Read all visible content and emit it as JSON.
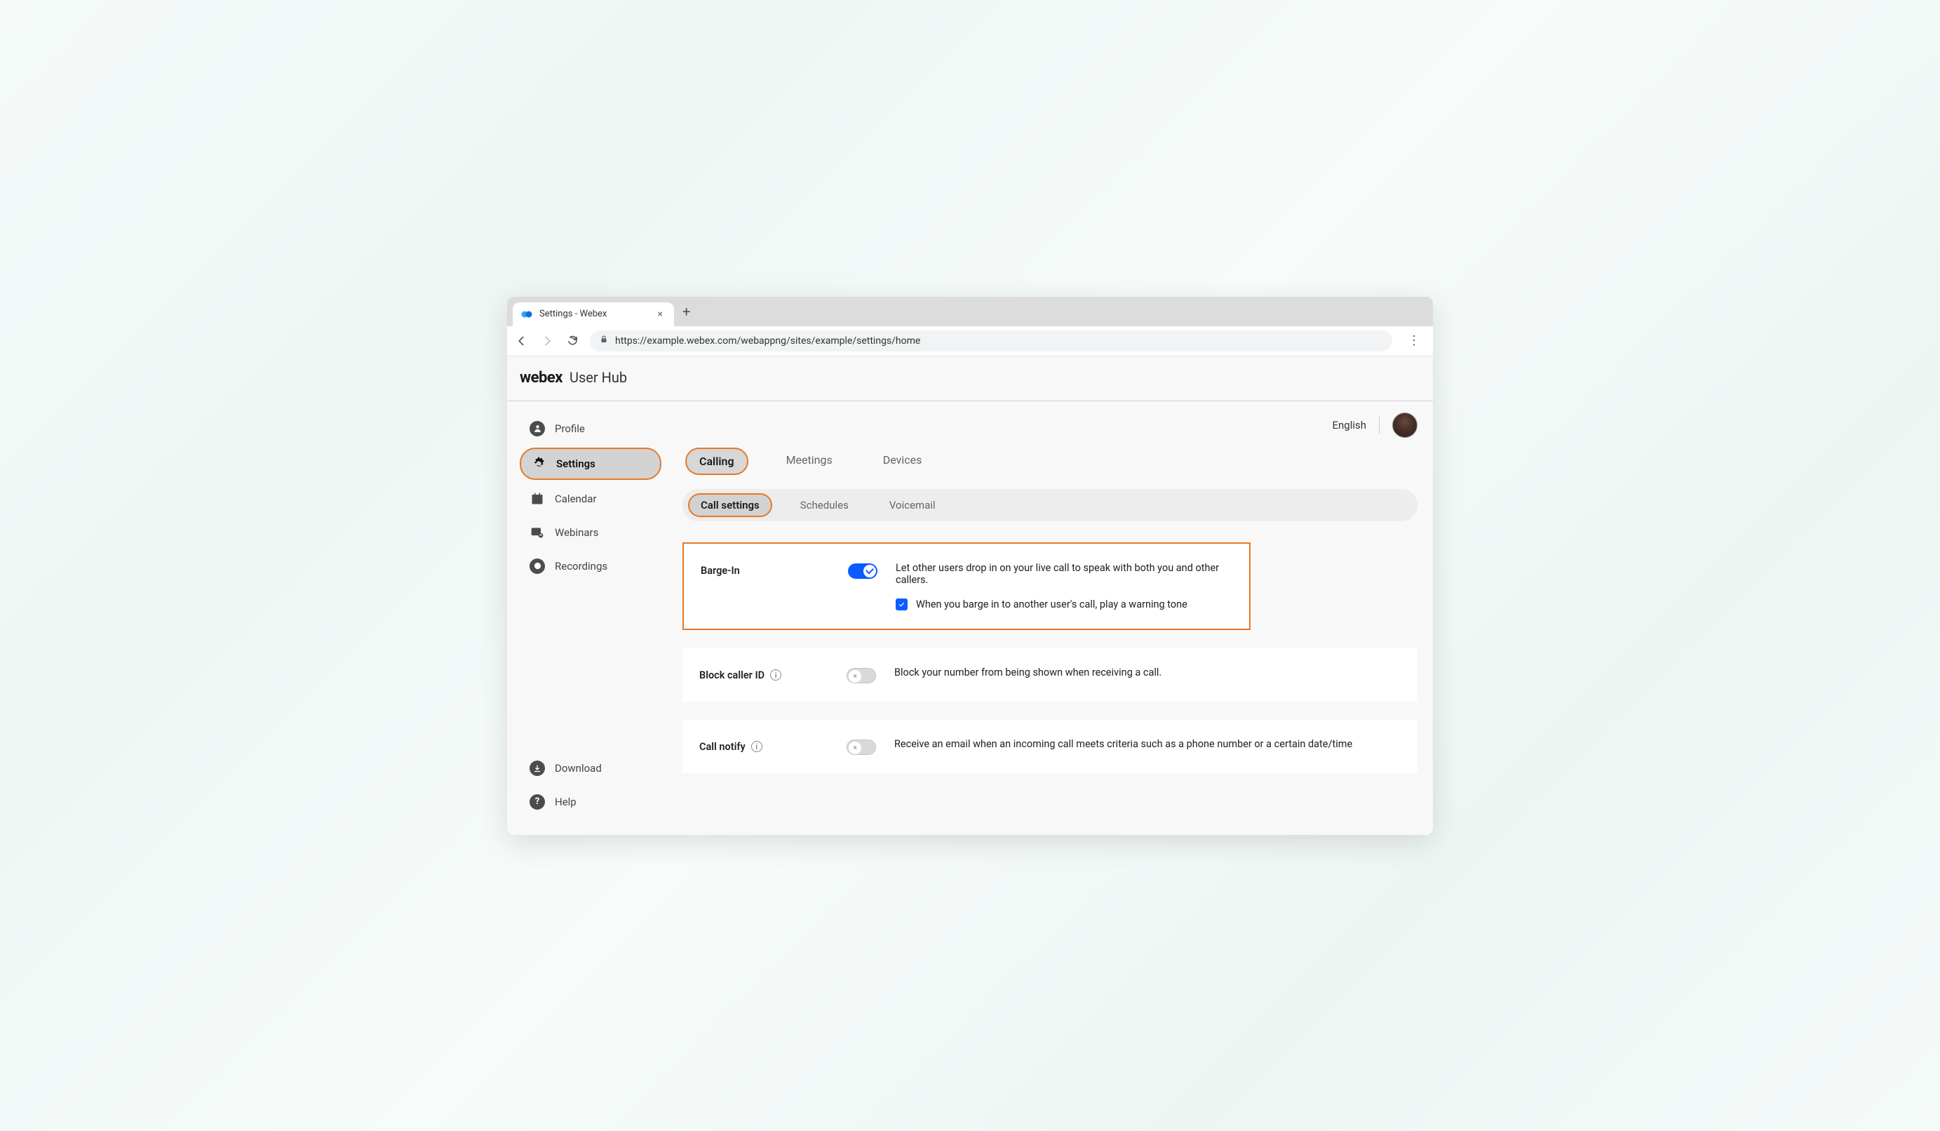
{
  "browser": {
    "tab_title": "Settings - Webex",
    "url": "https://example.webex.com/webappng/sites/example/settings/home"
  },
  "header": {
    "brand": "webex",
    "sub": "User Hub"
  },
  "sidebar": {
    "items": [
      {
        "label": "Profile"
      },
      {
        "label": "Settings"
      },
      {
        "label": "Calendar"
      },
      {
        "label": "Webinars"
      },
      {
        "label": "Recordings"
      }
    ],
    "bottom": [
      {
        "label": "Download"
      },
      {
        "label": "Help"
      }
    ]
  },
  "topbar": {
    "language": "English"
  },
  "main_tabs": {
    "items": [
      "Calling",
      "Meetings",
      "Devices"
    ]
  },
  "sub_tabs": {
    "items": [
      "Call settings",
      "Schedules",
      "Voicemail"
    ]
  },
  "settings": {
    "barge_in": {
      "label": "Barge-In",
      "enabled": true,
      "description": "Let other users drop in on your live call to speak with both you and other callers.",
      "sub_option": {
        "checked": true,
        "label": "When you barge in to another user's call, play a warning tone"
      }
    },
    "block_caller_id": {
      "label": "Block caller ID",
      "enabled": false,
      "description": "Block your number from being shown when receiving a call."
    },
    "call_notify": {
      "label": "Call notify",
      "enabled": false,
      "description": "Receive an email when an incoming call meets criteria such as a phone number or a certain date/time"
    }
  }
}
